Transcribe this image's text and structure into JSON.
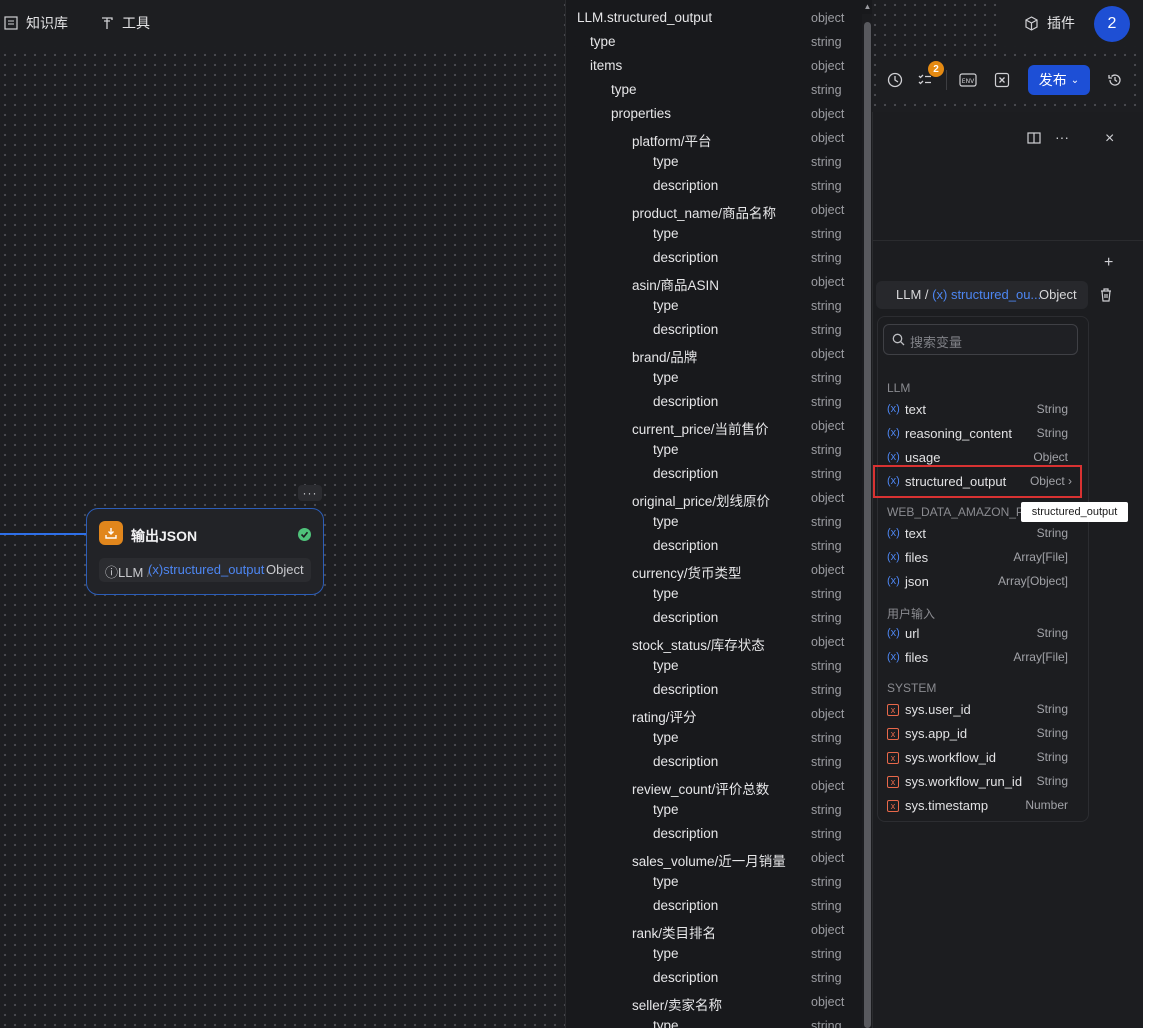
{
  "topnav": {
    "knowledge_label": "知识库",
    "tools_label": "工具",
    "plugins_label": "插件",
    "avatar_initial": "2"
  },
  "toolbar": {
    "badge_count": "2",
    "env_label": "ENV",
    "publish_label": "发布"
  },
  "node": {
    "title": "输出JSON",
    "var_source": "LLM",
    "var_name": "structured_output",
    "var_type": "Object",
    "more_label": "···"
  },
  "panel": {
    "var_row": {
      "source": "LLM /",
      "name": "structured_ou...",
      "type": "Object"
    },
    "search_placeholder": "搜索变量",
    "tooltip": "structured_output",
    "groups": [
      {
        "title": "LLM",
        "items": [
          {
            "name": "text",
            "type": "String"
          },
          {
            "name": "reasoning_content",
            "type": "String"
          },
          {
            "name": "usage",
            "type": "Object"
          },
          {
            "name": "structured_output",
            "type": "Object"
          }
        ]
      },
      {
        "title": "WEB_DATA_AMAZON_P",
        "items": [
          {
            "name": "text",
            "type": "String"
          },
          {
            "name": "files",
            "type": "Array[File]"
          },
          {
            "name": "json",
            "type": "Array[Object]"
          }
        ]
      },
      {
        "title": "用户输入",
        "items": [
          {
            "name": "url",
            "type": "String"
          },
          {
            "name": "files",
            "type": "Array[File]"
          }
        ]
      },
      {
        "title": "SYSTEM",
        "items": [
          {
            "name": "sys.user_id",
            "type": "String"
          },
          {
            "name": "sys.app_id",
            "type": "String"
          },
          {
            "name": "sys.workflow_id",
            "type": "String"
          },
          {
            "name": "sys.workflow_run_id",
            "type": "String"
          },
          {
            "name": "sys.timestamp",
            "type": "Number"
          }
        ]
      }
    ]
  },
  "tree": {
    "rows": [
      {
        "label": "LLM.structured_output",
        "type": "object",
        "depth": 0
      },
      {
        "label": "type",
        "type": "string",
        "depth": 1
      },
      {
        "label": "items",
        "type": "object",
        "depth": 1
      },
      {
        "label": "type",
        "type": "string",
        "depth": 2
      },
      {
        "label": "properties",
        "type": "object",
        "depth": 2
      },
      {
        "label": "platform/平台",
        "type": "object",
        "depth": 3
      },
      {
        "label": "type",
        "type": "string",
        "depth": 4
      },
      {
        "label": "description",
        "type": "string",
        "depth": 4
      },
      {
        "label": "product_name/商品名称",
        "type": "object",
        "depth": 3
      },
      {
        "label": "type",
        "type": "string",
        "depth": 4
      },
      {
        "label": "description",
        "type": "string",
        "depth": 4
      },
      {
        "label": "asin/商品ASIN",
        "type": "object",
        "depth": 3
      },
      {
        "label": "type",
        "type": "string",
        "depth": 4
      },
      {
        "label": "description",
        "type": "string",
        "depth": 4
      },
      {
        "label": "brand/品牌",
        "type": "object",
        "depth": 3
      },
      {
        "label": "type",
        "type": "string",
        "depth": 4
      },
      {
        "label": "description",
        "type": "string",
        "depth": 4
      },
      {
        "label": "current_price/当前售价",
        "type": "object",
        "depth": 3
      },
      {
        "label": "type",
        "type": "string",
        "depth": 4
      },
      {
        "label": "description",
        "type": "string",
        "depth": 4
      },
      {
        "label": "original_price/划线原价",
        "type": "object",
        "depth": 3
      },
      {
        "label": "type",
        "type": "string",
        "depth": 4
      },
      {
        "label": "description",
        "type": "string",
        "depth": 4
      },
      {
        "label": "currency/货币类型",
        "type": "object",
        "depth": 3
      },
      {
        "label": "type",
        "type": "string",
        "depth": 4
      },
      {
        "label": "description",
        "type": "string",
        "depth": 4
      },
      {
        "label": "stock_status/库存状态",
        "type": "object",
        "depth": 3
      },
      {
        "label": "type",
        "type": "string",
        "depth": 4
      },
      {
        "label": "description",
        "type": "string",
        "depth": 4
      },
      {
        "label": "rating/评分",
        "type": "object",
        "depth": 3
      },
      {
        "label": "type",
        "type": "string",
        "depth": 4
      },
      {
        "label": "description",
        "type": "string",
        "depth": 4
      },
      {
        "label": "review_count/评价总数",
        "type": "object",
        "depth": 3
      },
      {
        "label": "type",
        "type": "string",
        "depth": 4
      },
      {
        "label": "description",
        "type": "string",
        "depth": 4
      },
      {
        "label": "sales_volume/近一月销量",
        "type": "object",
        "depth": 3
      },
      {
        "label": "type",
        "type": "string",
        "depth": 4
      },
      {
        "label": "description",
        "type": "string",
        "depth": 4
      },
      {
        "label": "rank/类目排名",
        "type": "object",
        "depth": 3
      },
      {
        "label": "type",
        "type": "string",
        "depth": 4
      },
      {
        "label": "description",
        "type": "string",
        "depth": 4
      },
      {
        "label": "seller/卖家名称",
        "type": "object",
        "depth": 3
      },
      {
        "label": "type",
        "type": "string",
        "depth": 4
      }
    ]
  },
  "colors": {
    "accent": "#1d4fd6",
    "highlight_border": "#d93232",
    "badge": "#e58a12",
    "node_icon": "#e1861c"
  }
}
